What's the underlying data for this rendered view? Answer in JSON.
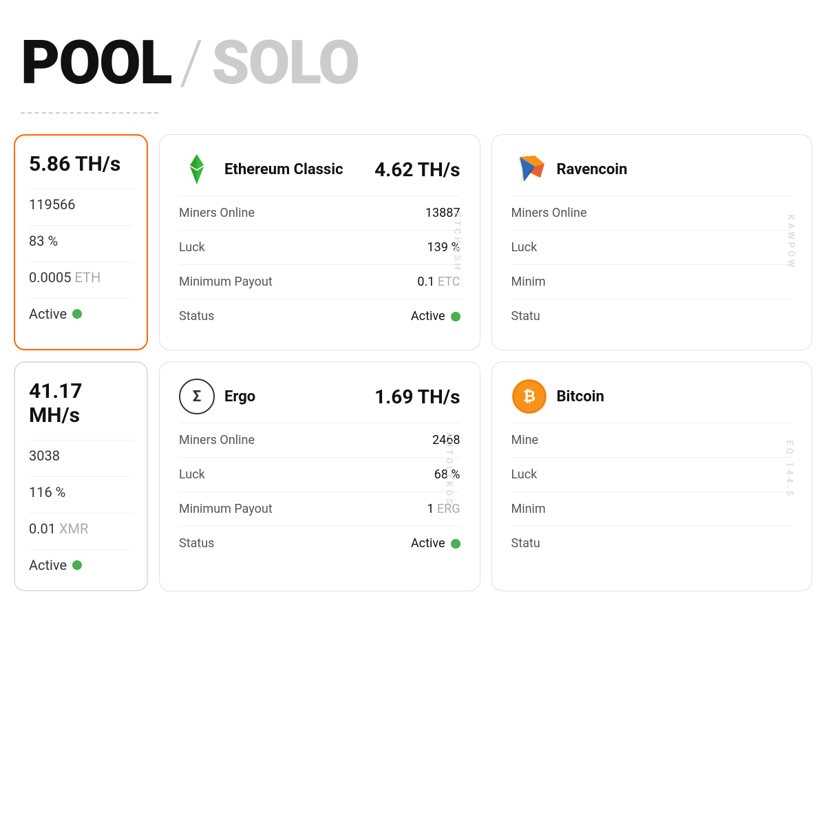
{
  "header": {
    "pool_label": "POOL",
    "slash": "/",
    "solo_label": "SOLO"
  },
  "cards": {
    "top_left": {
      "hashrate": "5.86 TH/s",
      "miners": "119566",
      "luck": "83 %",
      "min_payout": "0.0005",
      "min_payout_currency": "ETH",
      "status": "Active",
      "border_color": "#ff6600"
    },
    "bottom_left": {
      "hashrate": "41.17 MH/s",
      "miners": "3038",
      "luck": "116 %",
      "min_payout": "0.01",
      "min_payout_currency": "XMR",
      "status": "Active",
      "border_color": "#e0e0e0"
    },
    "etc": {
      "name": "Ethereum Classic",
      "hashrate": "4.62 TH/s",
      "algo": "ETCHASH",
      "miners_label": "Miners Online",
      "miners_value": "13887",
      "luck_label": "Luck",
      "luck_value": "139 %",
      "min_payout_label": "Minimum Payout",
      "min_payout_value": "0.1",
      "min_payout_currency": "ETC",
      "status_label": "Status",
      "status_value": "Active"
    },
    "ergo": {
      "name": "Ergo",
      "hashrate": "1.69 TH/s",
      "algo": "AUTOLYKOS",
      "miners_label": "Miners Online",
      "miners_value": "2468",
      "luck_label": "Luck",
      "luck_value": "68 %",
      "min_payout_label": "Minimum Payout",
      "min_payout_value": "1",
      "min_payout_currency": "ERG",
      "status_label": "Status",
      "status_value": "Active"
    },
    "rvn": {
      "name": "Ravencoin",
      "algo": "KAWPOW",
      "miners_label": "Miners Online",
      "luck_label": "Luck",
      "min_payout_label": "Minimum Payout",
      "status_label": "Status"
    },
    "btc": {
      "name": "Bitcoin",
      "algo": "EQ 144.5",
      "miners_label": "Miners Online",
      "luck_label": "Luck",
      "min_payout_label": "Minimum Payout",
      "status_label": "Status"
    }
  },
  "colors": {
    "orange": "#ff6600",
    "green": "#4caf50",
    "border": "#e0e0e0",
    "text_muted": "#aaa"
  }
}
